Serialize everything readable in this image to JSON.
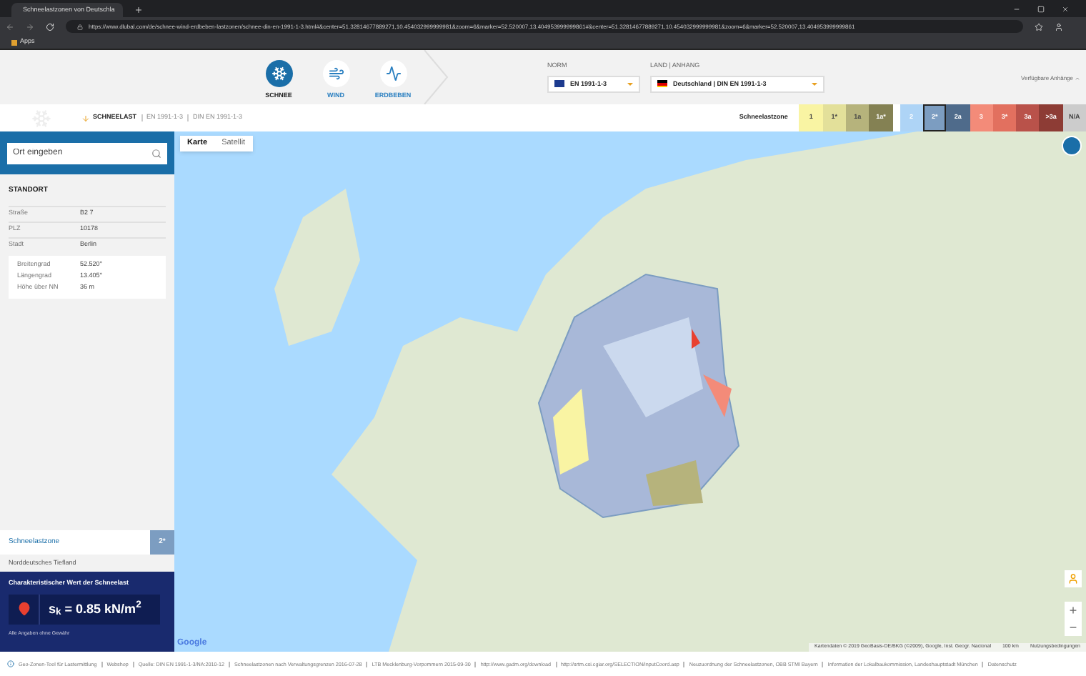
{
  "browser": {
    "tab_title": "Schneelastzonen von Deutschla",
    "url": "https://www.dlubal.com/de/schnee-wind-erdbeben-lastzonen/schnee-din-en-1991-1-3.html#&center=51.32814677889271,10.454032999999981&zoom=6&marker=52.520007,13.404953999999861#&center=51.32814677889271,10.454032999999981&zoom=6&marker=52.520007,13.404953999999861",
    "bookmarks": [
      "Apps"
    ]
  },
  "nav": {
    "items": [
      {
        "label": "SCHNEE",
        "kind": "snow",
        "selected": true
      },
      {
        "label": "WIND",
        "kind": "wind",
        "selected": false
      },
      {
        "label": "ERDBEBEN",
        "kind": "quake",
        "selected": false
      }
    ],
    "norm": {
      "label": "NORM",
      "value": "EN 1991-1-3"
    },
    "country": {
      "label": "LAND | ANHANG",
      "value": "Deutschland | DIN EN 1991-1-3"
    },
    "attachments": "Verfügbare Anhänge"
  },
  "breadcrumb": [
    "SCHNEELAST",
    "EN 1991-1-3",
    "DIN EN 1991-1-3"
  ],
  "legend": {
    "title": "Schneelastzone",
    "zones": [
      {
        "label": "1",
        "color": "#f9f4a3",
        "selected": false
      },
      {
        "label": "1*",
        "color": "#e3e09a",
        "selected": false
      },
      {
        "label": "1a",
        "color": "#b6b37c",
        "selected": false
      },
      {
        "label": "1a*",
        "color": "#848153",
        "selected": false
      },
      {
        "label": "2",
        "color": "#aed4f6",
        "selected": false
      },
      {
        "label": "2*",
        "color": "#7c9dc1",
        "selected": true
      },
      {
        "label": "2a",
        "color": "#4f6b8b",
        "selected": false
      },
      {
        "label": "3",
        "color": "#f38b79",
        "selected": false
      },
      {
        "label": "3*",
        "color": "#e2705f",
        "selected": false
      },
      {
        "label": "3a",
        "color": "#b9524a",
        "selected": false
      },
      {
        "label": ">3a",
        "color": "#8d3c35",
        "selected": false
      },
      {
        "label": "N/A",
        "color": "#cccccc",
        "selected": false
      }
    ]
  },
  "search": {
    "placeholder": "Ort eingeben"
  },
  "location": {
    "title": "STANDORT",
    "rows": [
      {
        "label": "Straße",
        "value": "B2 7"
      },
      {
        "label": "PLZ",
        "value": "10178"
      },
      {
        "label": "Stadt",
        "value": "Berlin"
      }
    ],
    "coords": [
      {
        "label": "Breitengrad",
        "value": "52.520°"
      },
      {
        "label": "Längengrad",
        "value": "13.405°"
      },
      {
        "label": "Höhe über NN",
        "value": "36 m"
      }
    ]
  },
  "zone": {
    "label": "Schneelastzone",
    "value": "2*",
    "region": "Norddeutsches Tiefland"
  },
  "result": {
    "title": "Charakteristischer Wert der Schneelast",
    "value": "s$_{k}$ = 0.85 kN/m$^{2}$",
    "note": "Alle Angaben ohne Gewähr"
  },
  "map": {
    "logo": "Google",
    "types": [
      {
        "label": "Karte",
        "selected": true
      },
      {
        "label": "Satellit",
        "selected": false
      }
    ],
    "zoom": [
      "+",
      "−"
    ],
    "attribution": "Kartendaten © 2019 GeoBasis-DE/BKG (©2009), Google, Inst. Geogr. Nacional",
    "scale": "100 km",
    "terms": "Nutzungsbedingungen"
  },
  "footer": [
    "Geo-Zonen-Tool für Lastermittlung",
    "Webshop",
    "Quelle: DIN EN 1991-1-3/NA:2010-12",
    "Schneelastzonen nach Verwaltungsgrenzen 2016-07-28",
    "LTB Mecklenburg-Vorpommern 2015-09-30",
    "http://www.gadm.org/download",
    "http://srtm.csi.cgiar.org/SELECTION/inputCoord.asp",
    "Neuzuordnung der Schneelastzonen, OBB STMI Bayern",
    "Information der Lokalbaukommission, Landeshauptstadt München",
    "Datenschutz"
  ]
}
